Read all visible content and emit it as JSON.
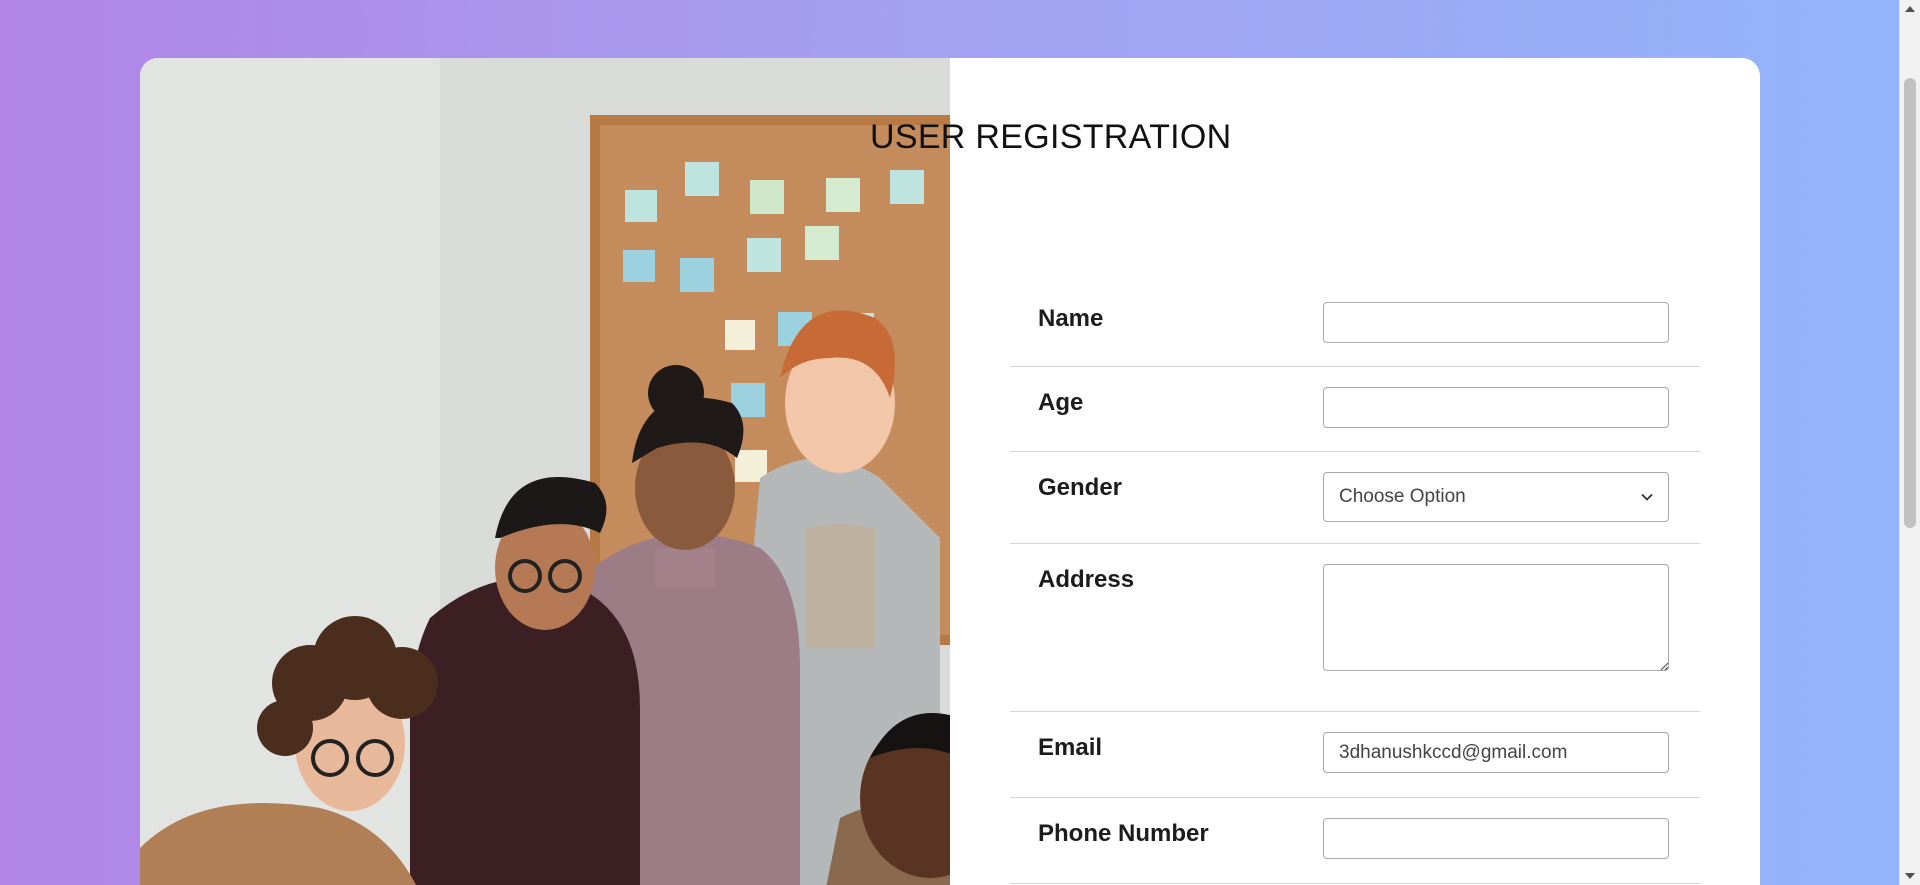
{
  "page": {
    "title": "USER REGISTRATION"
  },
  "photo": {
    "icon": "team-photo"
  },
  "form": {
    "name": {
      "label": "Name",
      "value": "",
      "placeholder": ""
    },
    "age": {
      "label": "Age",
      "value": "",
      "placeholder": ""
    },
    "gender": {
      "label": "Gender",
      "selected": "Choose Option"
    },
    "address": {
      "label": "Address",
      "value": "",
      "placeholder": ""
    },
    "email": {
      "label": "Email",
      "value": "3dhanushkccd@gmail.com",
      "placeholder": ""
    },
    "phone": {
      "label": "Phone Number",
      "value": "",
      "placeholder": ""
    }
  },
  "colors": {
    "gradient_left": "#b184e6",
    "gradient_right": "#92b5fb",
    "card_bg": "#ffffff",
    "border": "#a8a8a8"
  }
}
